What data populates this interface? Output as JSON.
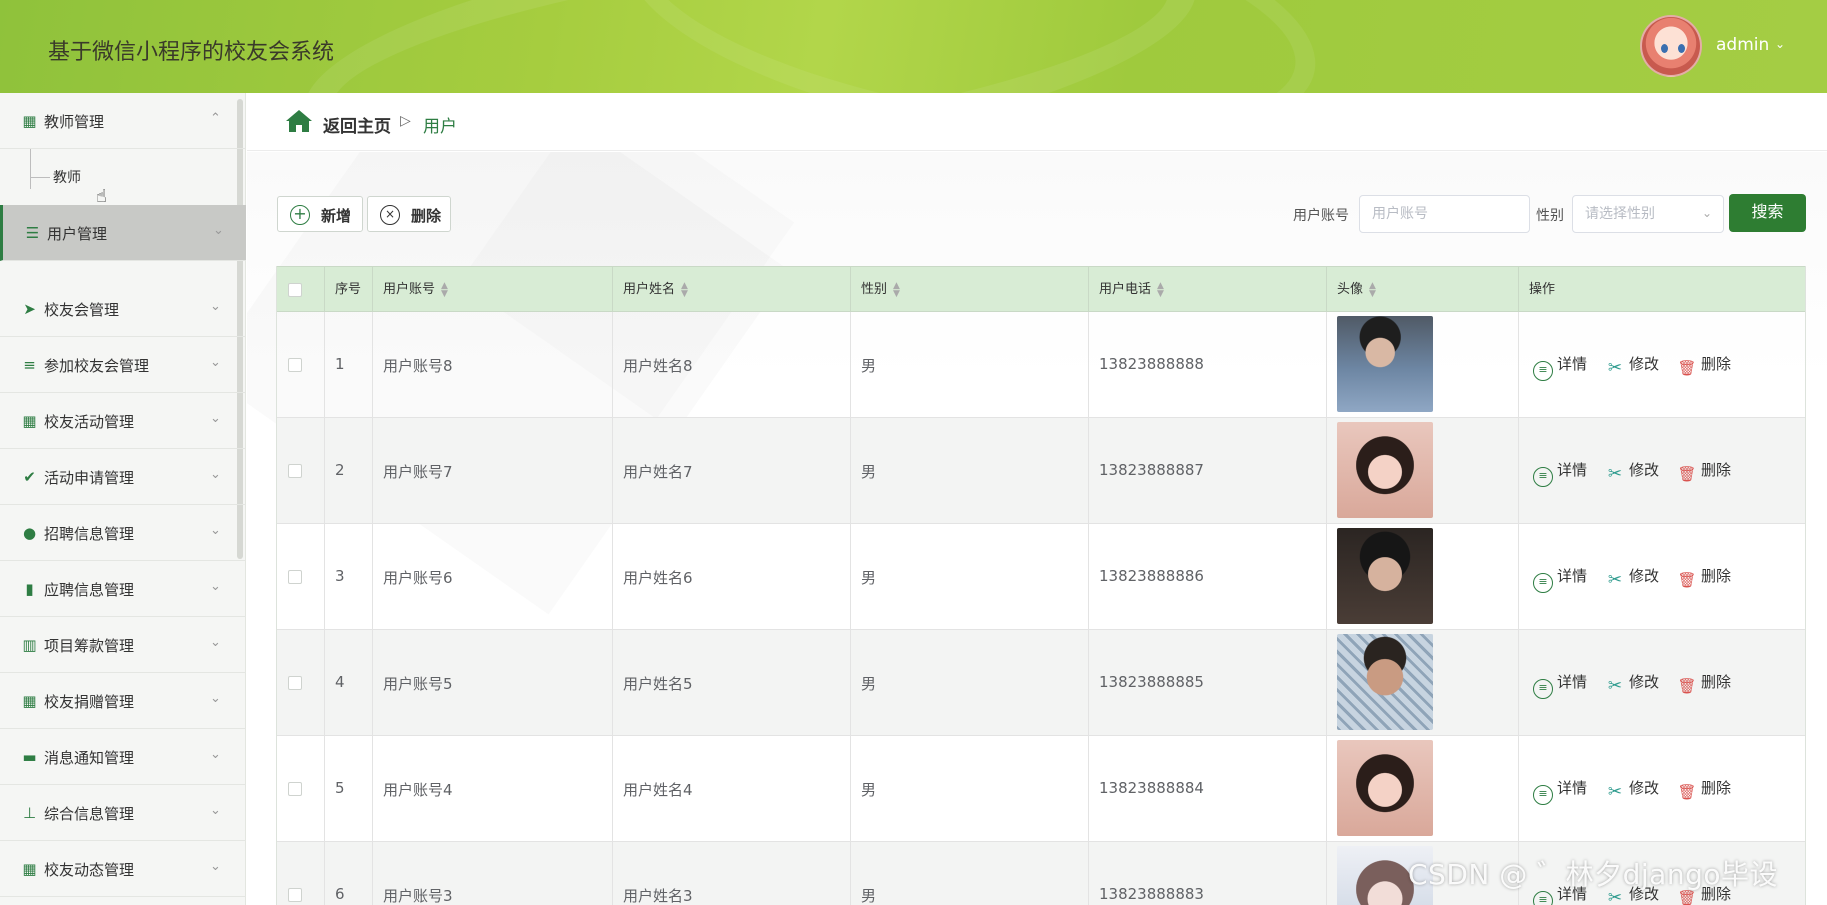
{
  "app": {
    "title": "基于微信小程序的校友会系统"
  },
  "user": {
    "name": "admin",
    "caret": "⌄"
  },
  "sidebar": {
    "items": [
      {
        "name": "teacher-mgmt",
        "icon": "grid-icon",
        "glyph": "▦",
        "label": "教师管理",
        "caret": "⌃",
        "expanded": true,
        "children": [
          {
            "label": "教师"
          }
        ]
      },
      {
        "name": "user-mgmt",
        "icon": "sliders-icon",
        "glyph": "☰",
        "label": "用户管理",
        "caret": "⌄",
        "active": true
      },
      {
        "name": "alumni-assoc-mgmt",
        "icon": "paper-plane-icon",
        "glyph": "➤",
        "label": "校友会管理",
        "caret": "⌄"
      },
      {
        "name": "join-assoc-mgmt",
        "icon": "list-icon",
        "glyph": "≡",
        "label": "参加校友会管理",
        "caret": "⌄"
      },
      {
        "name": "alumni-activity-mgmt",
        "icon": "grid-icon",
        "glyph": "▦",
        "label": "校友活动管理",
        "caret": "⌄"
      },
      {
        "name": "activity-apply-mgmt",
        "icon": "clipboard-icon",
        "glyph": "✔",
        "label": "活动申请管理",
        "caret": "⌄"
      },
      {
        "name": "recruit-info-mgmt",
        "icon": "bulb-icon",
        "glyph": "●",
        "label": "招聘信息管理",
        "caret": "⌄"
      },
      {
        "name": "apply-info-mgmt",
        "icon": "book-icon",
        "glyph": "▮",
        "label": "应聘信息管理",
        "caret": "⌄"
      },
      {
        "name": "fundraise-mgmt",
        "icon": "bar-chart-icon",
        "glyph": "▥",
        "label": "项目筹款管理",
        "caret": "⌄"
      },
      {
        "name": "donation-mgmt",
        "icon": "grid-icon",
        "glyph": "▦",
        "label": "校友捐赠管理",
        "caret": "⌄"
      },
      {
        "name": "notice-mgmt",
        "icon": "ticket-icon",
        "glyph": "▬",
        "label": "消息通知管理",
        "caret": "⌄"
      },
      {
        "name": "general-info-mgmt",
        "icon": "stamp-icon",
        "glyph": "⊥",
        "label": "综合信息管理",
        "caret": "⌄"
      },
      {
        "name": "alumni-news-mgmt",
        "icon": "grid-icon",
        "glyph": "▦",
        "label": "校友动态管理",
        "caret": "⌄"
      }
    ]
  },
  "breadcrumb": {
    "home": "返回主页",
    "sep": "▷",
    "current": "用户"
  },
  "toolbar": {
    "add_label": "新增",
    "add_glyph": "+",
    "delete_label": "删除",
    "delete_glyph": "×"
  },
  "search": {
    "account_label": "用户账号",
    "account_placeholder": "用户账号",
    "gender_label": "性别",
    "gender_placeholder": "请选择性别",
    "button_label": "搜索"
  },
  "table": {
    "columns": [
      "序号",
      "用户账号",
      "用户姓名",
      "性别",
      "用户电话",
      "头像",
      "操作"
    ],
    "sortable": [
      "用户账号",
      "用户姓名",
      "性别",
      "用户电话",
      "头像"
    ],
    "actions": {
      "detail": "详情",
      "edit": "修改",
      "delete": "删除"
    },
    "rows": [
      {
        "index": "1",
        "account": "用户账号8",
        "name": "用户姓名8",
        "gender": "男",
        "phone": "13823888888",
        "avatar": "man-selfie-light-jacket"
      },
      {
        "index": "2",
        "account": "用户账号7",
        "name": "用户姓名7",
        "gender": "男",
        "phone": "13823888887",
        "avatar": "woman-selfie-long-hair"
      },
      {
        "index": "3",
        "account": "用户账号6",
        "name": "用户姓名6",
        "gender": "男",
        "phone": "13823888886",
        "avatar": "man-selfie-dark"
      },
      {
        "index": "4",
        "account": "用户账号5",
        "name": "用户姓名5",
        "gender": "男",
        "phone": "13823888885",
        "avatar": "man-fence-background"
      },
      {
        "index": "5",
        "account": "用户账号4",
        "name": "用户姓名4",
        "gender": "男",
        "phone": "13823888884",
        "avatar": "woman-selfie-long-hair"
      },
      {
        "index": "6",
        "account": "用户账号3",
        "name": "用户姓名3",
        "gender": "男",
        "phone": "13823888883",
        "avatar": "woman-light-portrait"
      }
    ]
  },
  "watermark": "CSDN @ ゛林夕django毕设",
  "colors": {
    "header_green": "#a6cd3f",
    "accent_green": "#2e7d32",
    "table_header": "#d8ecd5"
  }
}
